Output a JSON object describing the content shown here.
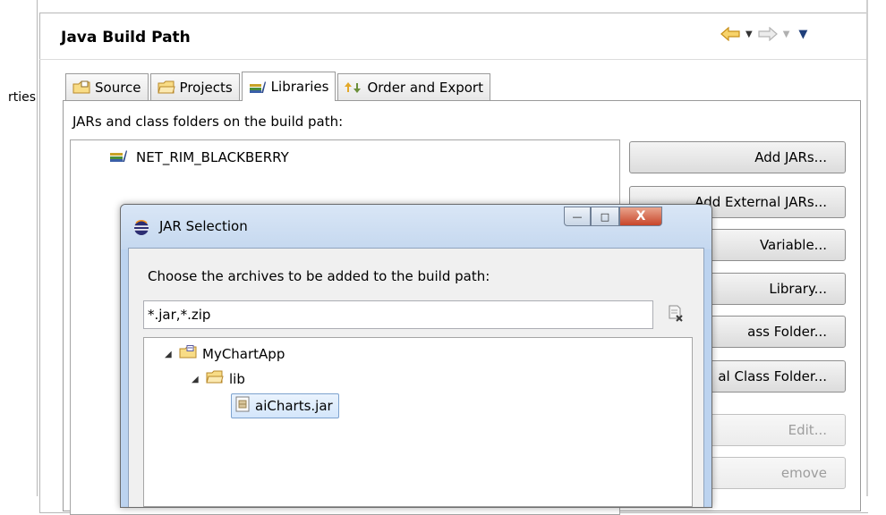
{
  "left_pane": {
    "truncated_text": "rties"
  },
  "header": {
    "title": "Java Build Path"
  },
  "colors": {
    "accent": "#f0b430",
    "selection": "#d4e6fb",
    "dialog_frame": "#bcd3ef"
  },
  "icons": {
    "back": "back-arrow-icon",
    "forward": "forward-arrow-icon",
    "menu": "view-menu-icon"
  },
  "tabs": [
    {
      "label": "Source",
      "icon": "source-folder-icon",
      "active": false
    },
    {
      "label": "Projects",
      "icon": "projects-folder-icon",
      "active": false
    },
    {
      "label": "Libraries",
      "icon": "libraries-icon",
      "active": true
    },
    {
      "label": "Order and Export",
      "icon": "order-export-icon",
      "active": false
    }
  ],
  "libraries": {
    "label": "JARs and class folders on the build path:",
    "entries": [
      "NET_RIM_BLACKBERRY"
    ],
    "buttons": [
      {
        "label": "Add JARs...",
        "enabled": true
      },
      {
        "label": "Add External JARs...",
        "enabled": true
      },
      {
        "label": "Variable...",
        "enabled": true
      },
      {
        "label": "Library...",
        "enabled": true
      },
      {
        "label": "ass Folder...",
        "enabled": true
      },
      {
        "label": "al Class Folder...",
        "enabled": true
      },
      {
        "label": "Edit...",
        "enabled": false
      },
      {
        "label": "emove",
        "enabled": false
      }
    ]
  },
  "dialog": {
    "title": "JAR Selection",
    "prompt": "Choose the archives to be added to the build path:",
    "filter_value": "*.jar,*.zip",
    "window_buttons": {
      "minimize": "—",
      "maximize": "□",
      "close": "X"
    },
    "tree": {
      "project": "MyChartApp",
      "folder": "lib",
      "file": "aiCharts.jar"
    }
  }
}
